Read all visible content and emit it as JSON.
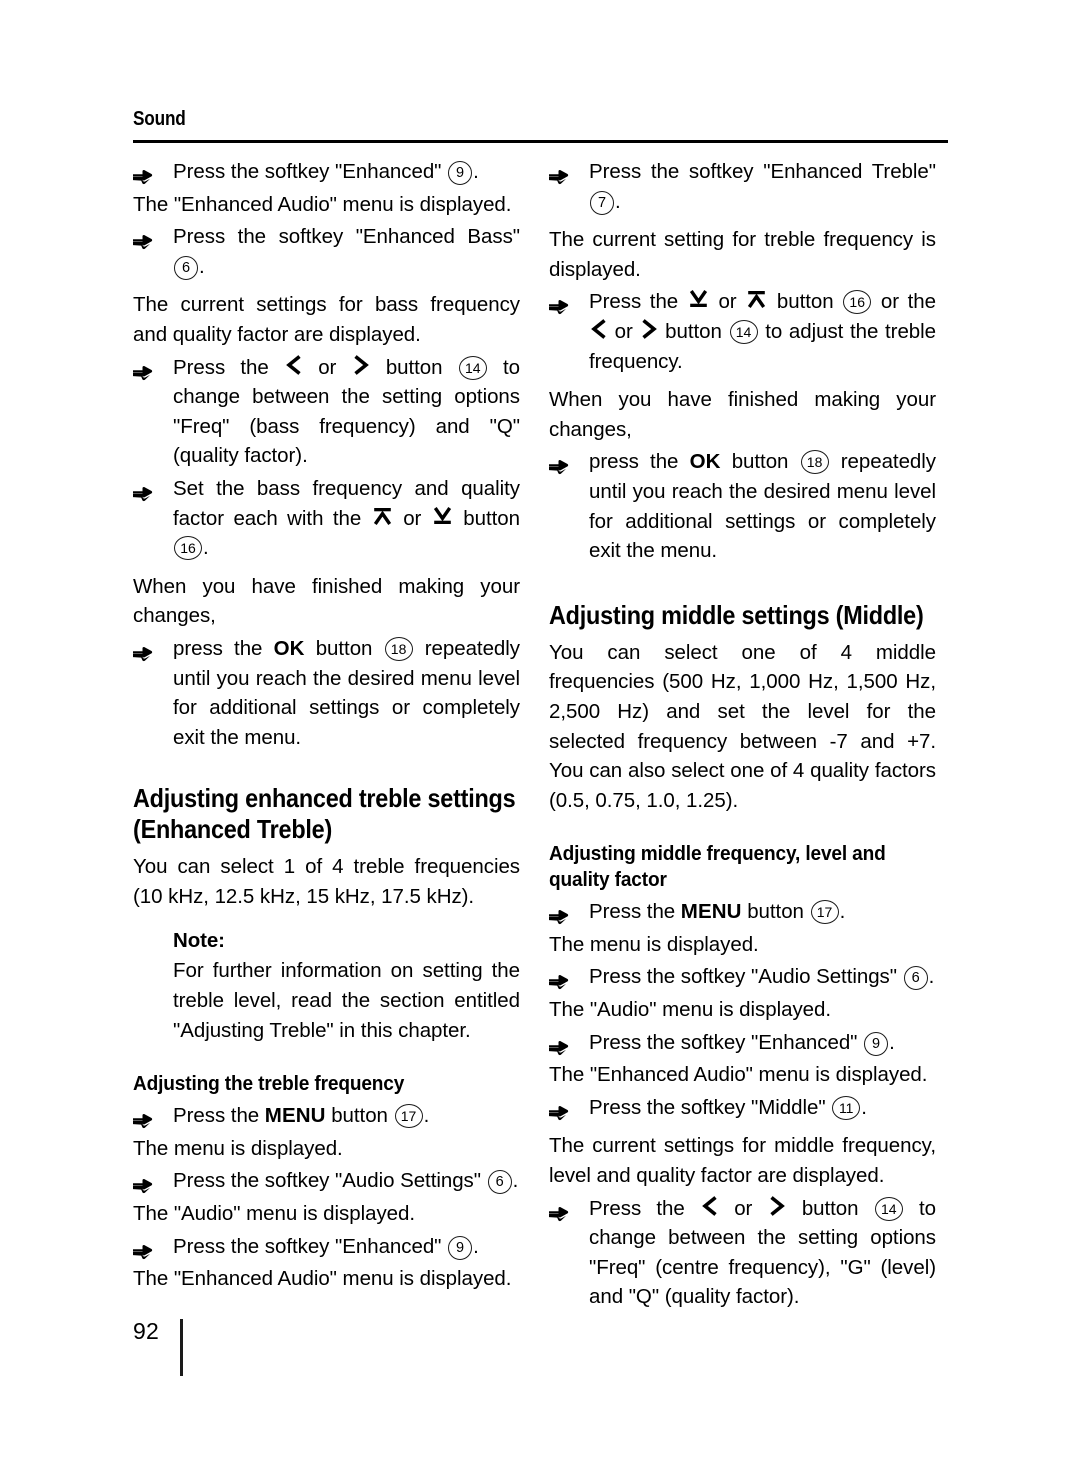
{
  "page": {
    "running_head": "Sound",
    "folio": "92"
  },
  "icons": {
    "bullet": "pointing-hand-icon",
    "left": "left-chevron-icon",
    "right": "right-chevron-icon",
    "up": "up-arrow-bar-icon",
    "down": "down-arrow-bar-icon"
  },
  "left_column": {
    "step_enhanced": {
      "t1": "Press the softkey \"Enhanced\" ",
      "ref": "9",
      "t2": "."
    },
    "result_enhanced_audio": "The \"Enhanced Audio\" menu is displayed.",
    "step_enhanced_bass": {
      "t1": "Press the softkey \"Enhanced Bass\" ",
      "ref": "6",
      "t2": "."
    },
    "result_bass_settings": "The current settings for bass frequency and quality factor are displayed.",
    "step_lr_button": {
      "t1": "Press the ",
      "t2": " or ",
      "t3": " button ",
      "ref": "14",
      "t4": " to change between the setting options \"Freq\" (bass frequency) and \"Q\" (quality factor)."
    },
    "step_set_bass": {
      "t1": "Set the bass frequency and quality factor each with the ",
      "t2": " or ",
      "t3": " button ",
      "ref": "16",
      "t4": "."
    },
    "when_finished": "When you have finished making your changes,",
    "step_ok": {
      "t1": "press the ",
      "bold": "OK",
      "t2": " button ",
      "ref": "18",
      "t3": " repeatedly until you reach the desired menu level for additional settings or completely exit the menu."
    },
    "heading_enhanced_treble": "Adjusting enhanced treble settings (Enhanced Treble)",
    "intro_treble": "You can select 1 of 4 treble frequencies (10 kHz, 12.5 kHz, 15 kHz, 17.5 kHz).",
    "note_title": "Note:",
    "note_body": "For further information on setting the treble level, read the section entitled \"Adjusting Treble\" in this chapter.",
    "heading_treble_freq": "Adjusting the treble frequency",
    "step_menu": {
      "t1": "Press the ",
      "bold": "MENU",
      "t2": " button ",
      "ref": "17",
      "t3": "."
    },
    "result_menu": "The menu is displayed.",
    "step_audio_settings": {
      "t1": "Press the softkey \"Audio Settings\" ",
      "ref": "6",
      "t2": "."
    },
    "result_audio_menu": "The \"Audio\" menu is displayed.",
    "step_enhanced2": {
      "t1": "Press the softkey \"Enhanced\" ",
      "ref": "9",
      "t2": "."
    },
    "result_enhanced_audio2": "The \"Enhanced Audio\" menu is displayed."
  },
  "right_column": {
    "step_enhanced_treble": {
      "t1": "Press the softkey \"Enhanced Treble\" ",
      "ref": "7",
      "t2": "."
    },
    "result_treble_setting": "The current setting for treble frequency is displayed.",
    "step_adjust_treble": {
      "t1": "Press the ",
      "t2": " or ",
      "t3": " button ",
      "ref1": "16",
      "t4": " or the ",
      "t5": " or ",
      "t6": " button ",
      "ref2": "14",
      "t7": " to adjust the treble frequency."
    },
    "when_finished": "When you have finished making your changes,",
    "step_ok": {
      "t1": "press the ",
      "bold": "OK",
      "t2": " button ",
      "ref": "18",
      "t3": " repeatedly until you reach the desired menu level for additional settings or completely exit the menu."
    },
    "heading_middle": "Adjusting middle settings (Middle)",
    "intro_middle": "You can select one of 4 middle frequencies (500 Hz, 1,000 Hz, 1,500 Hz, 2,500 Hz) and set the level for the selected frequency between -7 and +7. You can also select one of 4 quality factors (0.5, 0.75, 1.0, 1.25).",
    "heading_middle_freq": "Adjusting middle frequency, level and quality factor",
    "step_menu": {
      "t1": "Press the ",
      "bold": "MENU",
      "t2": " button ",
      "ref": "17",
      "t3": "."
    },
    "result_menu": "The menu is displayed.",
    "step_audio_settings": {
      "t1": "Press the softkey \"Audio Settings\" ",
      "ref": "6",
      "t2": "."
    },
    "result_audio_menu": "The \"Audio\" menu is displayed.",
    "step_enhanced": {
      "t1": "Press the softkey \"Enhanced\" ",
      "ref": "9",
      "t2": "."
    },
    "result_enhanced_audio": "The \"Enhanced Audio\" menu is displayed.",
    "step_middle": {
      "t1": "Press the softkey \"Middle\" ",
      "ref": "11",
      "t2": "."
    },
    "result_middle_settings": "The current settings for middle frequency, level and quality factor are displayed.",
    "step_lr_button": {
      "t1": "Press the ",
      "t2": " or ",
      "t3": " button ",
      "ref": "14",
      "t4": " to change between the setting options \"Freq\" (centre frequency), \"G\" (level) and \"Q\" (quality factor)."
    }
  }
}
